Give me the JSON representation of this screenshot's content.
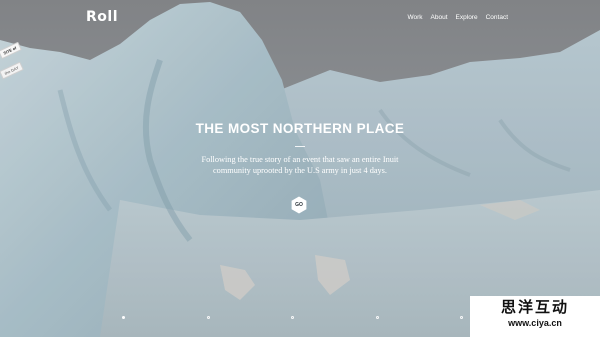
{
  "brand": {
    "logo_text": "Roll"
  },
  "nav": {
    "items": [
      {
        "label": "Work"
      },
      {
        "label": "About"
      },
      {
        "label": "Explore"
      },
      {
        "label": "Contact"
      }
    ]
  },
  "ribbon": {
    "badge_top": "SITE of",
    "badge_bottom": "the DAY"
  },
  "hero": {
    "title": "THE MOST NORTHERN PLACE",
    "description": "Following the true story of an event that saw an entire Inuit community uprooted by the U.S army in just 4 days.",
    "go_label": "GO"
  },
  "slider": {
    "count": 5,
    "active_index": 0
  },
  "watermark": {
    "cn_text": "思洋互动",
    "url_text": "www.ciya.cn"
  },
  "colors": {
    "overlay": "#000000",
    "text": "#ffffff",
    "button_bg": "#ffffff",
    "button_text": "#2a3238"
  }
}
